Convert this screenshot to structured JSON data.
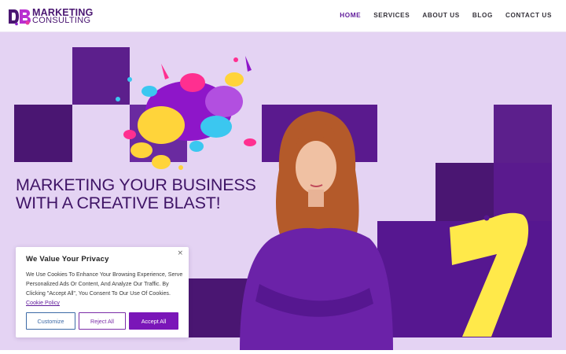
{
  "header": {
    "logo": {
      "mark": "DB",
      "line1": "MARKETING",
      "line2": "CONSULTING"
    },
    "nav": [
      "HOME",
      "SERVICES",
      "ABOUT US",
      "BLOG",
      "CONTACT US"
    ],
    "active_nav": "HOME"
  },
  "hero": {
    "headline_line1": "MARKETING YOUR BUSINESS",
    "headline_line2": "WITH A CREATIVE BLAST!"
  },
  "cookie": {
    "title": "We Value Your Privacy",
    "close": "×",
    "text": "We Use Cookies To Enhance Your Browsing Experience, Serve Personalized Ads Or Content, And Analyze Our Traffic. By Clicking \"Accept All\", You Consent To Our Use Of Cookies.",
    "link": "Cookie Policy",
    "customize": "Customize",
    "reject": "Reject All",
    "accept": "Accept All"
  },
  "colors": {
    "brand_purple": "#5f1a9a",
    "hero_bg": "#e4d3f3",
    "accent_yellow": "#ffe94a",
    "accept_button": "#7a16b8"
  },
  "icons": [
    "db-logo-mark",
    "close-icon",
    "paint-splash",
    "number-seven-shape"
  ]
}
